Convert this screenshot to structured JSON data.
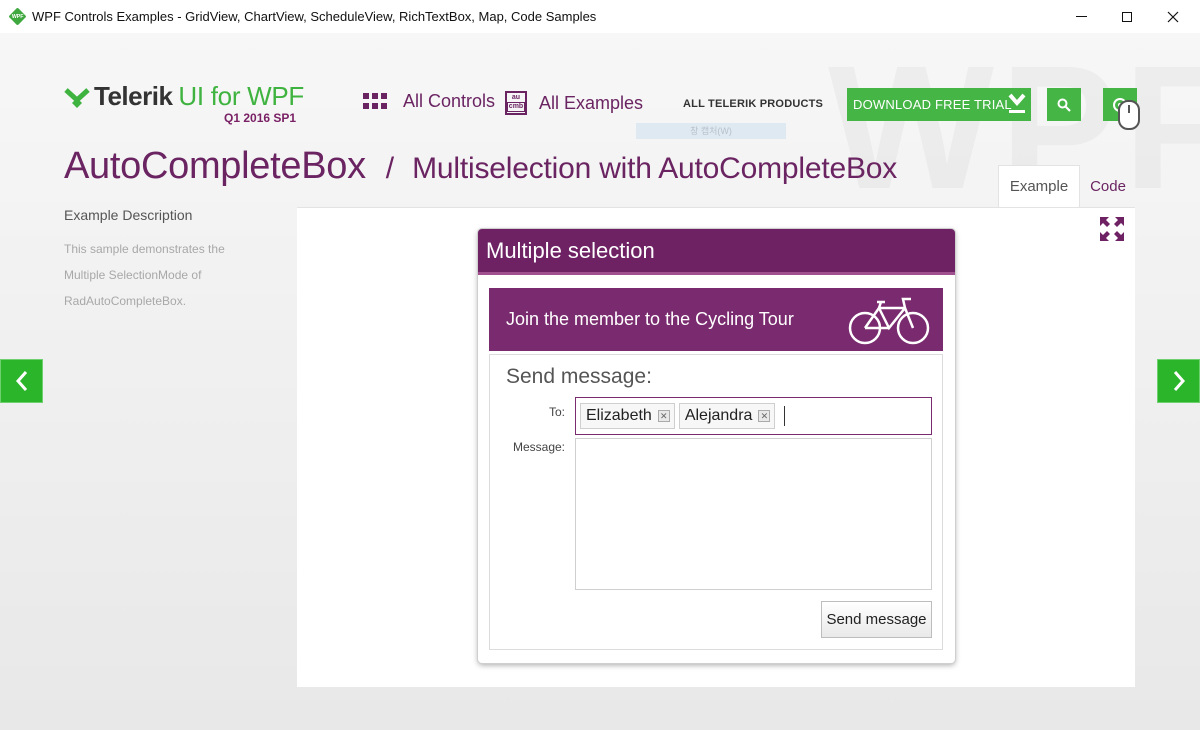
{
  "window": {
    "title": "WPF Controls Examples - GridView, ChartView, ScheduleView, RichTextBox, Map, Code Samples",
    "app_icon": "telerik-wpf-app-icon",
    "controls": [
      "minimize",
      "maximize",
      "close"
    ]
  },
  "header": {
    "brand": "Telerik",
    "product": "UI for WPF",
    "version": "Q1 2016 SP1",
    "nav": {
      "all_controls": "All Controls",
      "all_examples": "All Examples",
      "all_products": "ALL TELERIK PRODUCTS"
    },
    "tooltip_ghost": "창 캡처(W)",
    "download_button": "DOWNLOAD FREE TRIAL",
    "watermark": "WPF"
  },
  "page": {
    "control_name": "AutoCompleteBox",
    "separator": "/",
    "example_name": "Multiselection with AutoCompleteBox",
    "tabs": [
      "Example",
      "Code"
    ],
    "active_tab": "Example"
  },
  "description": {
    "title": "Example Description",
    "lines": [
      "This sample demonstrates the",
      "Multiple SelectionMode of",
      "RadAutoCompleteBox."
    ]
  },
  "demo": {
    "card_title": "Multiple selection",
    "banner_text": "Join the member to the Cycling Tour",
    "form_title": "Send message:",
    "to_label": "To:",
    "message_label": "Message:",
    "tokens": [
      "Elizabeth",
      "Alejandra"
    ],
    "message_value": "",
    "send_button": "Send message"
  },
  "colors": {
    "accent_purple": "#6e2264",
    "brand_green": "#45b545",
    "arrow_green": "#2bb52b"
  }
}
